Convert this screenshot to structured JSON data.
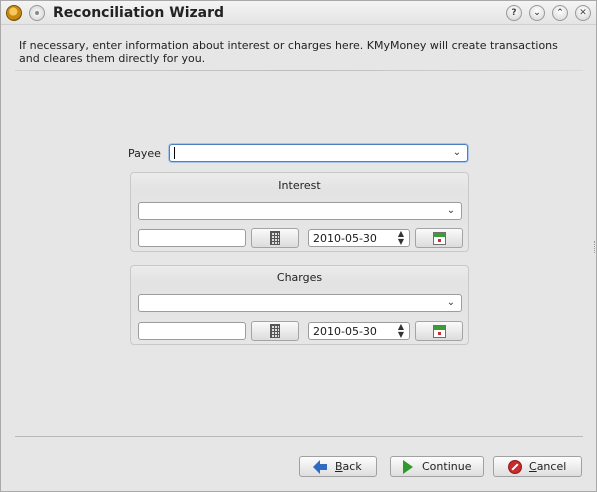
{
  "window": {
    "title": "Reconciliation Wizard",
    "help_btn": "?",
    "shade_btn": "⌄",
    "max_btn": "⌃",
    "close_btn": "✕"
  },
  "header": {
    "text": "If necessary, enter information about interest or charges here. KMyMoney will create transactions and cleares them directly for you."
  },
  "form": {
    "payee_label": "Payee",
    "payee_value": "",
    "interest": {
      "title": "Interest",
      "category_value": "",
      "amount_value": "",
      "date": "2010-05-30"
    },
    "charges": {
      "title": "Charges",
      "category_value": "",
      "amount_value": "",
      "date": "2010-05-30"
    }
  },
  "buttons": {
    "back": {
      "pre": "",
      "accel": "B",
      "post": "ack"
    },
    "continue": {
      "label": "Continue"
    },
    "cancel": {
      "pre": "",
      "accel": "C",
      "post": "ancel"
    }
  },
  "icons": {
    "app": "kmymoney-app-icon",
    "back": "arrow-left-icon",
    "continue": "arrow-right-icon",
    "cancel": "cancel-icon",
    "calculator": "calculator-icon",
    "calendar": "calendar-icon"
  }
}
